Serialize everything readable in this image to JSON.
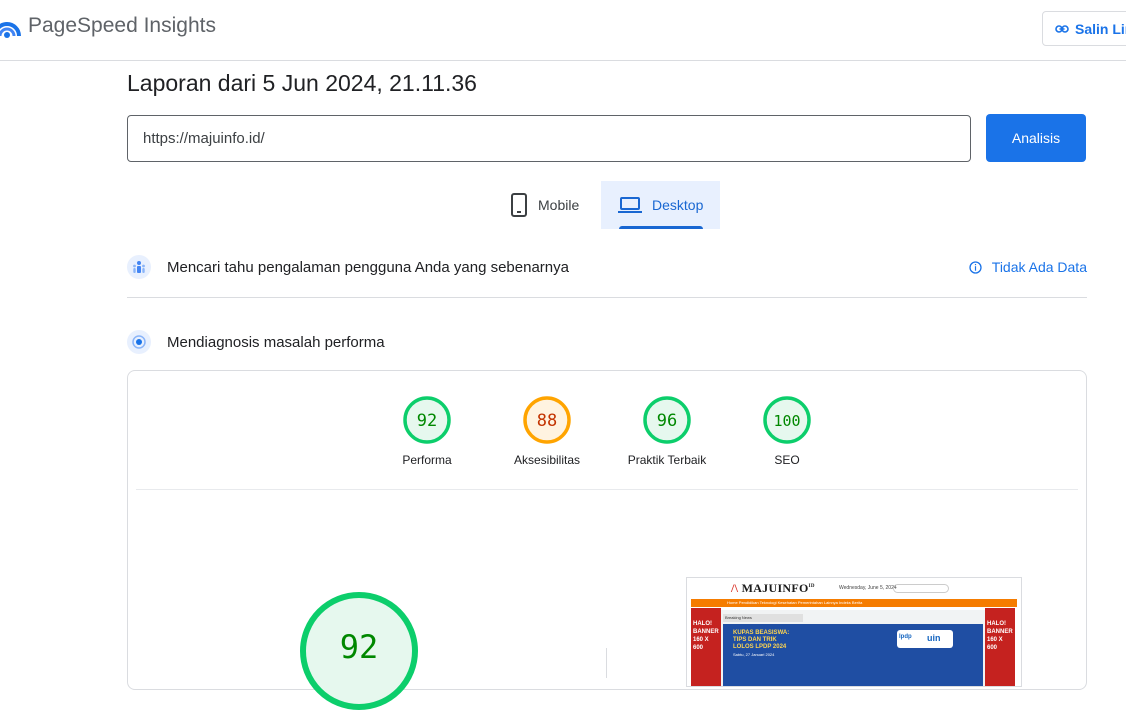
{
  "app": {
    "brand": "PageSpeed Insights",
    "copy_link_label": "Salin Link"
  },
  "report": {
    "title": "Laporan dari 5 Jun 2024, 21.11.36",
    "url_value": "https://majuinfo.id/",
    "analyze_label": "Analisis"
  },
  "tabs": [
    {
      "label": "Mobile",
      "icon": "smartphone-icon",
      "selected": false
    },
    {
      "label": "Desktop",
      "icon": "laptop-icon",
      "selected": true
    }
  ],
  "field_data": {
    "heading": "Mencari tahu pengalaman pengguna Anda yang sebenarnya",
    "status": "Tidak Ada Data",
    "status_icon": "info-icon"
  },
  "lab_data": {
    "heading": "Mendiagnosis masalah performa"
  },
  "scores": [
    {
      "label": "Performa",
      "value": "92",
      "color": "#0cce6b",
      "text_color": "#008800",
      "fill": "#e6f8ee"
    },
    {
      "label": "Aksesibilitas",
      "value": "88",
      "color": "#ffa400",
      "text_color": "#c33300",
      "fill": "#fff3e0"
    },
    {
      "label": "Praktik Terbaik",
      "value": "96",
      "color": "#0cce6b",
      "text_color": "#008800",
      "fill": "#e6f8ee"
    },
    {
      "label": "SEO",
      "value": "100",
      "color": "#0cce6b",
      "text_color": "#008800",
      "fill": "#e6f8ee"
    }
  ],
  "main_score": {
    "value": "92",
    "color": "#0cce6b",
    "text_color": "#008800"
  },
  "screenshot": {
    "brand_mark": "MAJUINFO",
    "brand_mark_sup": "ID",
    "date_text": "Wednesday, June 5, 2024",
    "search_placeholder": "Search",
    "nav_text": "Home  Pendidikan  Teknologi  Kesehatan  Pemerintahan  Lainnya  Indeks Berita",
    "side_banner": "HALO! BANNER 160 X 600",
    "breaking": "Breaking News",
    "headline": "KUPAS BEASISWA: TIPS DAN TRIK LOLOS LPDP 2024",
    "sub": "Sabtu, 27 Januari 2024",
    "partner_lpdp": "lpdp",
    "partner_uin": "uin"
  }
}
